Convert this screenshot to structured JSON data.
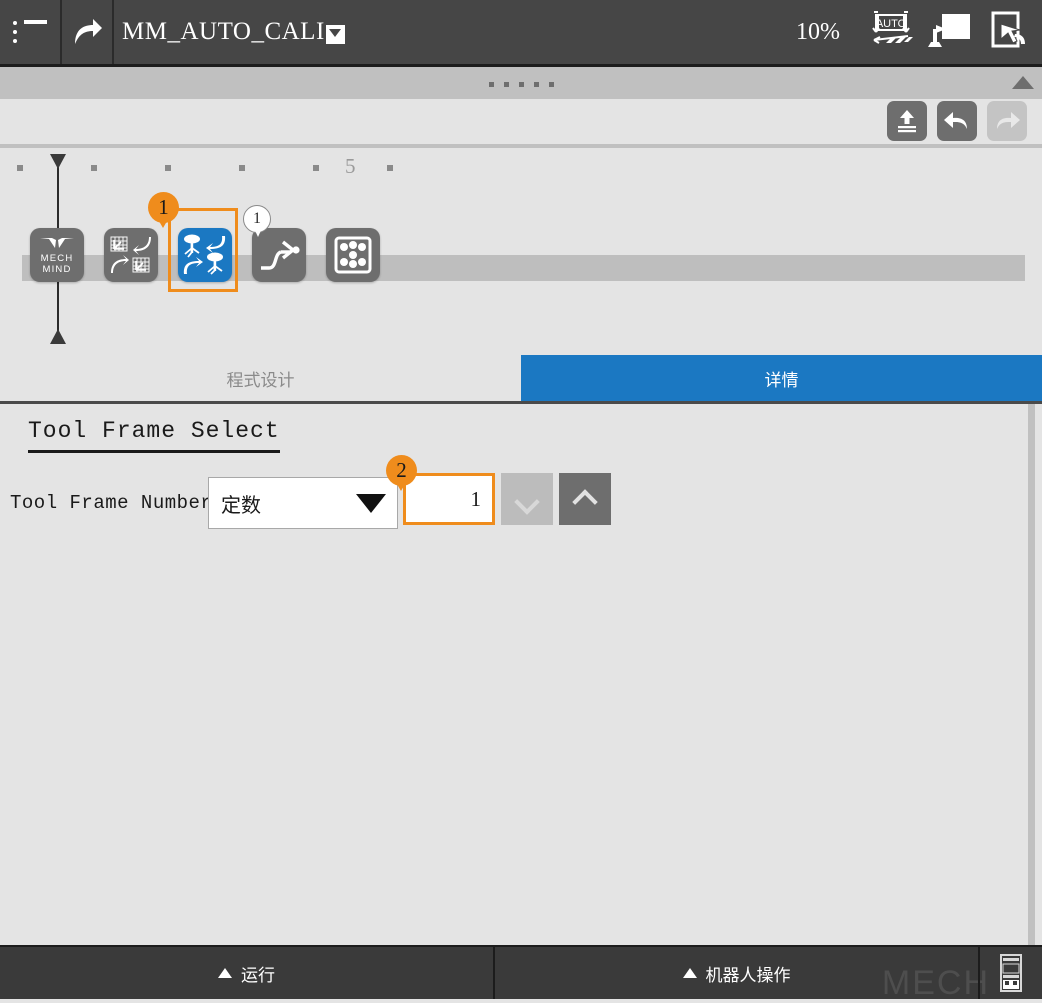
{
  "topbar": {
    "menu_icon": "hamburger-menu-icon",
    "share_icon": "share-arrow-icon",
    "program_title": "MM_AUTO_CALI",
    "title_dropdown_icon": "caret-down-icon",
    "speed_percent": "10%",
    "mode_icon": "auto-mode-icon",
    "mode_icon_label": "AUTO",
    "teach_icon": "teach-pendant-icon",
    "touch_icon": "touch-screen-icon"
  },
  "handlebar": {
    "drag_handle_icon": "drag-dots-handle",
    "collapse_icon": "collapse-up-arrow"
  },
  "edit_toolbar": {
    "upload_label": "upload-icon",
    "undo_label": "undo-icon",
    "redo_label": "redo-icon"
  },
  "canvas": {
    "ruler_label": "5",
    "ruler_tick_count": 7,
    "playhead_icon": "playhead-marker",
    "nodes": [
      {
        "id": "mech-mind",
        "icon": "mech-mind-logo",
        "line1": "MECH",
        "line2": "MIND",
        "selected": false
      },
      {
        "id": "frame-transform",
        "icon": "coordinate-transform-icon",
        "selected": false
      },
      {
        "id": "tool-frame-select",
        "icon": "tool-swap-icon",
        "selected": true
      },
      {
        "id": "move-path",
        "icon": "motion-path-icon",
        "selected": false
      },
      {
        "id": "pattern-grid",
        "icon": "pallet-pattern-icon",
        "selected": false
      }
    ],
    "selected_badge": "1",
    "node_count_badge": "1"
  },
  "tabs": [
    {
      "id": "program-design",
      "label": "程式设计",
      "active": false
    },
    {
      "id": "details",
      "label": "详情",
      "active": true
    }
  ],
  "detail": {
    "section_title": "Tool Frame Select",
    "field_label": "Tool Frame Number:",
    "combo_value": "定数",
    "combo_caret_icon": "caret-down-icon",
    "number_value": "1",
    "step_down_icon": "chevron-down-icon",
    "step_up_icon": "chevron-up-icon",
    "highlight_badge": "2"
  },
  "bottombar": {
    "run_label": "运行",
    "robot_label": "机器人操作",
    "jog_icon": "jog-panel-icon",
    "watermark": "MECH"
  },
  "colors": {
    "accent_blue": "#1b78c2",
    "highlight_orange": "#ef8c1c",
    "chrome_dark": "#464646",
    "panel_bg": "#e4e4e4"
  }
}
